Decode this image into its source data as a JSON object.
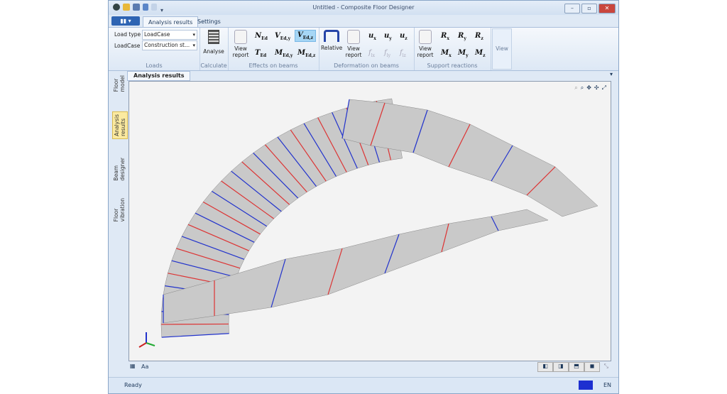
{
  "window": {
    "title": "Untitled - Composite Floor Designer",
    "minimize": "–",
    "restore": "▫",
    "close": "✕"
  },
  "app_button": "▮▮ ▾",
  "tabs": [
    "Analysis results",
    "Settings"
  ],
  "ribbon": {
    "loads": {
      "load_type_label": "Load type",
      "load_type_value": "LoadCase",
      "loadcase_label": "LoadCase",
      "loadcase_value": "Construction st...",
      "group": "Loads"
    },
    "calculate": {
      "analyse": "Analyse",
      "group": "Calculate"
    },
    "effects": {
      "view_report": "View report",
      "group": "Effects on beams",
      "N": "N",
      "N_sub": "Ed",
      "Vy": "V",
      "Vy_sub": "Ed,y",
      "Vz": "V",
      "Vz_sub": "Ed,z",
      "T": "T",
      "T_sub": "Ed",
      "My": "M",
      "My_sub": "Ed,y",
      "Mz": "M",
      "Mz_sub": "Ed,z"
    },
    "deformation": {
      "relative": "Relative",
      "view_report": "View report",
      "group": "Deformation on beams",
      "ux": "u",
      "ux_sub": "x",
      "uy": "u",
      "uy_sub": "y",
      "uz": "u",
      "uz_sub": "z",
      "fx": "f",
      "fx_sub": "lx",
      "fy": "f",
      "fy_sub": "ly",
      "fz": "f",
      "fz_sub": "lz"
    },
    "support": {
      "view_report": "View report",
      "group": "Support reactions",
      "Rx": "R",
      "Rx_sub": "x",
      "Ry": "R",
      "Ry_sub": "y",
      "Rz": "R",
      "Rz_sub": "z",
      "Mx": "M",
      "Mx_sub": "x",
      "My": "M",
      "My_sub": "y",
      "Mz": "M",
      "Mz_sub": "z"
    },
    "view": {
      "label": "View"
    }
  },
  "doc_tab": "Analysis results",
  "side_tabs": [
    "Floor model",
    "Analysis results",
    "Beam designer",
    "Floor vibration"
  ],
  "bottom": {
    "font_toggle": "Aa"
  },
  "status": {
    "text": "Ready",
    "language": "EN"
  }
}
